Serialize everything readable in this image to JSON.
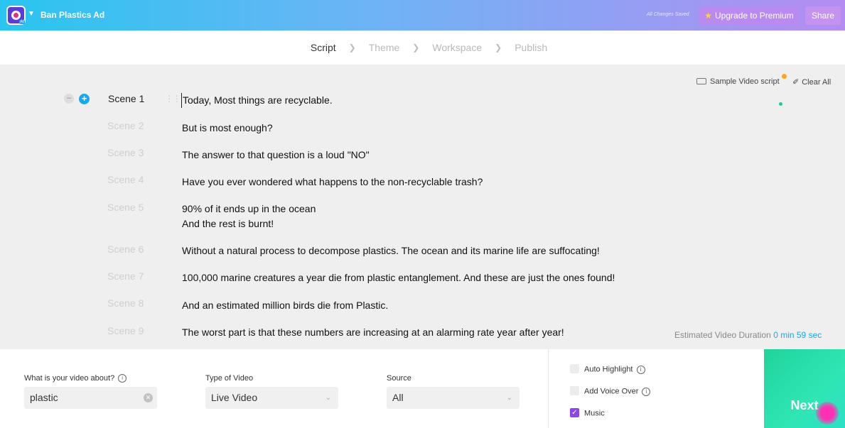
{
  "topbar": {
    "project_title": "Ban Plastics Ad",
    "saved_status": "All Changes Saved",
    "upgrade_label": "Upgrade to Premium",
    "share_label": "Share",
    "logo_badge": "AI"
  },
  "stepper": {
    "steps": [
      "Script",
      "Theme",
      "Workspace",
      "Publish"
    ],
    "active": "Script"
  },
  "toolbar": {
    "sample_script_label": "Sample Video script",
    "clear_all_label": "Clear All"
  },
  "scenes": [
    {
      "label": "Scene 1",
      "text": "Today, Most things are recyclable."
    },
    {
      "label": "Scene 2",
      "text": "But is most enough?"
    },
    {
      "label": "Scene 3",
      "text": "The answer to that question is a loud \"NO\""
    },
    {
      "label": "Scene 4",
      "text": "Have you ever wondered what happens to the non-recyclable trash?"
    },
    {
      "label": "Scene 5",
      "text": "90% of it ends up in the ocean",
      "text2": "And the rest is burnt!"
    },
    {
      "label": "Scene 6",
      "text": "Without a natural process to decompose plastics. The ocean and its marine life are suffocating!"
    },
    {
      "label": "Scene 7",
      "text": "100,000 marine creatures a year die from plastic entanglement. And these are just the ones found!"
    },
    {
      "label": "Scene 8",
      "text": "And an estimated million birds die from Plastic."
    },
    {
      "label": "Scene 9",
      "text": "The worst part is that these numbers are increasing at an alarming rate year after year!"
    }
  ],
  "duration": {
    "label": "Estimated Video Duration",
    "value": "0 min 59 sec"
  },
  "settings": {
    "about_label": "What is your video about?",
    "about_value": "plastic",
    "type_label": "Type of Video",
    "type_value": "Live Video",
    "source_label": "Source",
    "source_value": "All"
  },
  "options": [
    {
      "label": "Auto Highlight",
      "checked": false
    },
    {
      "label": "Add Voice Over",
      "checked": false
    },
    {
      "label": "Music",
      "checked": true
    }
  ],
  "next_label": "Next",
  "colors": {
    "accent_blue": "#16a8f0",
    "accent_purple": "#8b45e8",
    "next_green": "#1fd39b"
  }
}
